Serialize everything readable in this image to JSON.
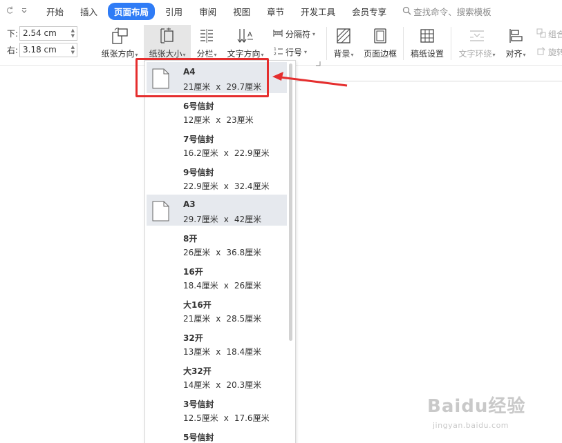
{
  "menubar": {
    "tabs": [
      {
        "label": "开始"
      },
      {
        "label": "插入"
      },
      {
        "label": "页面布局",
        "active": true
      },
      {
        "label": "引用"
      },
      {
        "label": "审阅"
      },
      {
        "label": "视图"
      },
      {
        "label": "章节"
      },
      {
        "label": "开发工具"
      },
      {
        "label": "会员专享"
      }
    ],
    "search_placeholder": "查找命令、搜索模板"
  },
  "ribbon": {
    "margin_bottom": {
      "label": "下:",
      "value": "2.54 cm"
    },
    "margin_right": {
      "label": "右:",
      "value": "3.18 cm"
    },
    "orientation_label": "纸张方向",
    "paper_size_label": "纸张大小",
    "columns_label": "分栏",
    "text_direction_label": "文字方向",
    "separator_label": "分隔符",
    "line_number_label": "行号",
    "background_label": "背景",
    "page_border_label": "页面边框",
    "manuscript_label": "稿纸设置",
    "text_wrap_label": "文字环绕",
    "align_label": "对齐",
    "group_label": "组合",
    "rotate_label": "旋转"
  },
  "paper_sizes": [
    {
      "name": "A4",
      "dims": [
        "21厘米",
        "29.7厘米"
      ],
      "highlighted": true,
      "thumb": true
    },
    {
      "name": "6号信封",
      "dims": [
        "12厘米",
        "23厘米"
      ]
    },
    {
      "name": "7号信封",
      "dims": [
        "16.2厘米",
        "22.9厘米"
      ]
    },
    {
      "name": "9号信封",
      "dims": [
        "22.9厘米",
        "32.4厘米"
      ]
    },
    {
      "name": "A3",
      "dims": [
        "29.7厘米",
        "42厘米"
      ],
      "highlighted": true,
      "thumb": true
    },
    {
      "name": "8开",
      "dims": [
        "26厘米",
        "36.8厘米"
      ]
    },
    {
      "name": "16开",
      "dims": [
        "18.4厘米",
        "26厘米"
      ]
    },
    {
      "name": "大16开",
      "dims": [
        "21厘米",
        "28.5厘米"
      ]
    },
    {
      "name": "32开",
      "dims": [
        "13厘米",
        "18.4厘米"
      ]
    },
    {
      "name": "大32开",
      "dims": [
        "14厘米",
        "20.3厘米"
      ]
    },
    {
      "name": "3号信封",
      "dims": [
        "12.5厘米",
        "17.6厘米"
      ]
    },
    {
      "name": "5号信封",
      "dims": [
        "",
        ""
      ]
    }
  ],
  "dims_separator": "x",
  "watermark": {
    "brand": "Baidu经验",
    "url": "jingyan.baidu.com"
  },
  "colors": {
    "accent": "#2f7cf6",
    "annotation": "#e52e2e",
    "highlight": "#e6e9ee"
  }
}
